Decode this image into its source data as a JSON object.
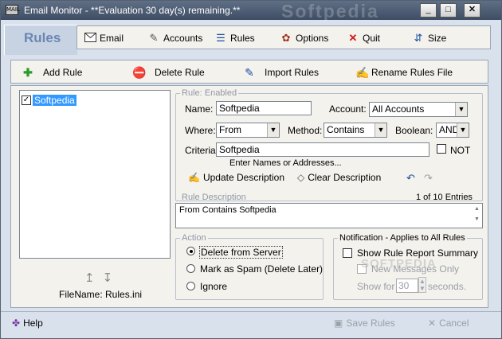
{
  "window": {
    "title": "Email Monitor - **Evaluation 30 day(s) remaining.**",
    "titlebar_watermark": "Softpedia",
    "app_icon_text": "MAIL",
    "controls": {
      "minimize": "_",
      "maximize": "□",
      "close": "✕"
    }
  },
  "header": {
    "rules_heading": "Rules"
  },
  "menu": {
    "email": "Email",
    "accounts": "Accounts",
    "rules": "Rules",
    "options": "Options",
    "quit": "Quit",
    "size": "Size"
  },
  "toolbar": {
    "add_rule": "Add Rule",
    "delete_rule": "Delete Rule",
    "import_rules": "Import Rules",
    "rename_rules_file": "Rename Rules File"
  },
  "rules_list": {
    "items": [
      {
        "label": "Softpedia",
        "checked": true,
        "selected": true
      }
    ],
    "filename": "FileName: Rules.ini"
  },
  "rule": {
    "legend": "Rule: Enabled",
    "name_label": "Name:",
    "name_value": "Softpedia",
    "account_label": "Account:",
    "account_value": "All Accounts",
    "where_label": "Where:",
    "where_value": "From",
    "method_label": "Method:",
    "method_value": "Contains",
    "boolean_label": "Boolean:",
    "boolean_value": "AND",
    "criteria_label": "Criteria:",
    "criteria_value": "Softpedia",
    "not_label": "NOT",
    "criteria_hint": "Enter Names or Addresses...",
    "update_description": "Update Description",
    "clear_description": "Clear Description"
  },
  "description": {
    "label": "Rule Description",
    "entries": "1 of 10 Entries",
    "text": "From Contains Softpedia"
  },
  "action": {
    "legend": "Action",
    "options": [
      "Delete from Server",
      "Mark as Spam  (Delete Later)",
      "Ignore"
    ],
    "selected": "Delete from Server"
  },
  "notification": {
    "legend": "Notification - Applies to All Rules",
    "show_report": "Show Rule Report Summary",
    "new_messages_only": "New Messages Only",
    "show_for_label": "Show for",
    "show_for_value": "30",
    "seconds_label": "seconds."
  },
  "footer": {
    "help": "Help",
    "save_rules": "Save Rules",
    "cancel": "Cancel"
  },
  "watermark": "SOFTPEDIA"
}
